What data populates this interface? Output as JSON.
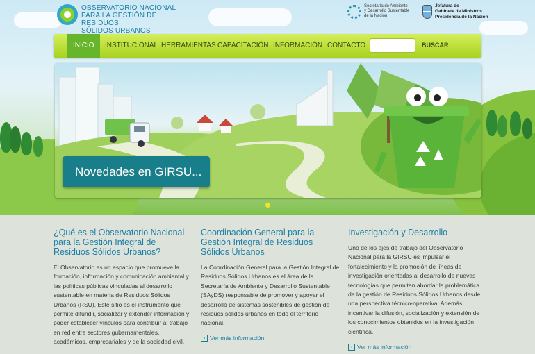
{
  "header": {
    "logo_line1": "OBSERVATORIO NACIONAL",
    "logo_line2": "PARA LA GESTIÓN DE RESIDUOS",
    "logo_line3": "SÓLIDOS URBANOS",
    "partner1_line1": "Secretaría de Ambiente",
    "partner1_line2": "y Desarrollo Sustentable",
    "partner1_line3": "de la Nación",
    "partner2_line1": "Jefatura de",
    "partner2_line2": "Gabinete de Ministros",
    "partner2_line3": "Presidencia de la Nación"
  },
  "nav": {
    "items": [
      "INICIO",
      "INSTITUCIONAL",
      "HERRAMIENTAS",
      "CAPACITACIÓN",
      "INFORMACIÓN",
      "CONTACTO"
    ],
    "search_value": "",
    "search_button": "BUSCAR"
  },
  "slider": {
    "caption": "Novedades en GIRSU..."
  },
  "columns": [
    {
      "title": "¿Qué es el Observatorio Nacional para la Gestión Integral de Residuos Sólidos Urbanos?",
      "body": "El Observatorio es un espacio que promueve la formación, información y comunicación ambiental y las políticas públicas vinculadas al desarrollo sustentable en materia de Residuos Sólidos Urbanos (RSU). Este sitio es el instrumento que permite difundir, socializar y extender información y poder establecer vínculos para contribuir al trabajo en red entre sectores gubernamentales, académicos, empresariales y de la sociedad civil."
    },
    {
      "title": "Coordinación General para la Gestión Integral de Residuos Sólidos Urbanos",
      "body": "La Coordinación General para la Gestión Integral de Residuos Sólidos Urbanos es el área de la Secretaría de Ambiente y Desarrollo Sustentable (SAyDS) responsable de promover y apoyar el desarrollo de sistemas sostenibles de gestión de residuos sólidos urbanos en todo el territorio nacional.",
      "more": "Ver más información"
    },
    {
      "title": "Investigación y Desarrollo",
      "body": "Uno de los ejes de trabajo del Observatorio Nacional para la GIRSU es impulsar el fortalecimiento y la promoción de líneas de investigación orientadas al desarrollo de nuevas tecnologías que permitan abordar la problemática de la gestión de Residuos Sólidos Urbanos desde una perspectiva técnico-operativa. Además, incentivar la difusión, socialización y extensión de los conocimientos obtenidos en la investigación científica.",
      "more": "Ver más información"
    }
  ],
  "colors": {
    "nav_green": "#a8d21f",
    "active_green": "#67b52a",
    "caption_teal": "#187f8a",
    "heading_blue": "#1d7fa6"
  }
}
